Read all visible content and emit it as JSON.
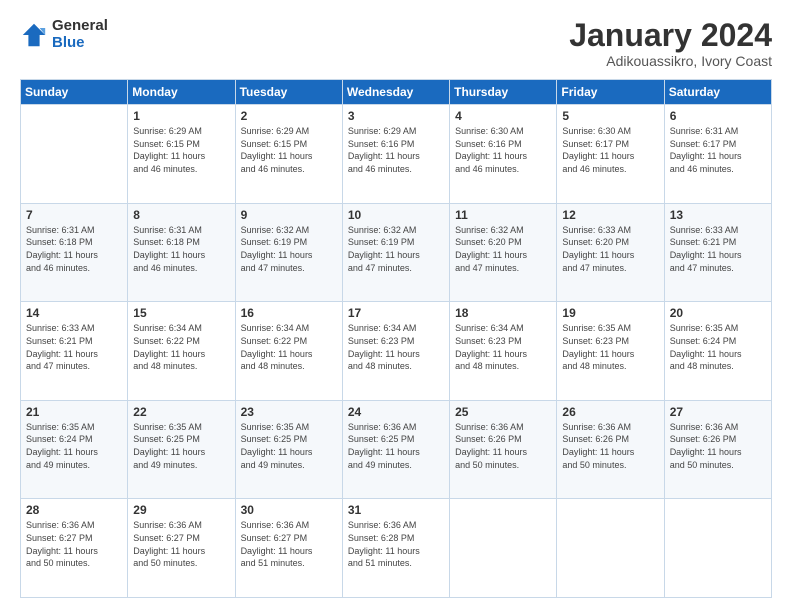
{
  "logo": {
    "general": "General",
    "blue": "Blue"
  },
  "title": "January 2024",
  "subtitle": "Adikouassikro, Ivory Coast",
  "days_header": [
    "Sunday",
    "Monday",
    "Tuesday",
    "Wednesday",
    "Thursday",
    "Friday",
    "Saturday"
  ],
  "weeks": [
    [
      {
        "day": "",
        "info": ""
      },
      {
        "day": "1",
        "info": "Sunrise: 6:29 AM\nSunset: 6:15 PM\nDaylight: 11 hours\nand 46 minutes."
      },
      {
        "day": "2",
        "info": "Sunrise: 6:29 AM\nSunset: 6:15 PM\nDaylight: 11 hours\nand 46 minutes."
      },
      {
        "day": "3",
        "info": "Sunrise: 6:29 AM\nSunset: 6:16 PM\nDaylight: 11 hours\nand 46 minutes."
      },
      {
        "day": "4",
        "info": "Sunrise: 6:30 AM\nSunset: 6:16 PM\nDaylight: 11 hours\nand 46 minutes."
      },
      {
        "day": "5",
        "info": "Sunrise: 6:30 AM\nSunset: 6:17 PM\nDaylight: 11 hours\nand 46 minutes."
      },
      {
        "day": "6",
        "info": "Sunrise: 6:31 AM\nSunset: 6:17 PM\nDaylight: 11 hours\nand 46 minutes."
      }
    ],
    [
      {
        "day": "7",
        "info": "Sunrise: 6:31 AM\nSunset: 6:18 PM\nDaylight: 11 hours\nand 46 minutes."
      },
      {
        "day": "8",
        "info": "Sunrise: 6:31 AM\nSunset: 6:18 PM\nDaylight: 11 hours\nand 46 minutes."
      },
      {
        "day": "9",
        "info": "Sunrise: 6:32 AM\nSunset: 6:19 PM\nDaylight: 11 hours\nand 47 minutes."
      },
      {
        "day": "10",
        "info": "Sunrise: 6:32 AM\nSunset: 6:19 PM\nDaylight: 11 hours\nand 47 minutes."
      },
      {
        "day": "11",
        "info": "Sunrise: 6:32 AM\nSunset: 6:20 PM\nDaylight: 11 hours\nand 47 minutes."
      },
      {
        "day": "12",
        "info": "Sunrise: 6:33 AM\nSunset: 6:20 PM\nDaylight: 11 hours\nand 47 minutes."
      },
      {
        "day": "13",
        "info": "Sunrise: 6:33 AM\nSunset: 6:21 PM\nDaylight: 11 hours\nand 47 minutes."
      }
    ],
    [
      {
        "day": "14",
        "info": "Sunrise: 6:33 AM\nSunset: 6:21 PM\nDaylight: 11 hours\nand 47 minutes."
      },
      {
        "day": "15",
        "info": "Sunrise: 6:34 AM\nSunset: 6:22 PM\nDaylight: 11 hours\nand 48 minutes."
      },
      {
        "day": "16",
        "info": "Sunrise: 6:34 AM\nSunset: 6:22 PM\nDaylight: 11 hours\nand 48 minutes."
      },
      {
        "day": "17",
        "info": "Sunrise: 6:34 AM\nSunset: 6:23 PM\nDaylight: 11 hours\nand 48 minutes."
      },
      {
        "day": "18",
        "info": "Sunrise: 6:34 AM\nSunset: 6:23 PM\nDaylight: 11 hours\nand 48 minutes."
      },
      {
        "day": "19",
        "info": "Sunrise: 6:35 AM\nSunset: 6:23 PM\nDaylight: 11 hours\nand 48 minutes."
      },
      {
        "day": "20",
        "info": "Sunrise: 6:35 AM\nSunset: 6:24 PM\nDaylight: 11 hours\nand 48 minutes."
      }
    ],
    [
      {
        "day": "21",
        "info": "Sunrise: 6:35 AM\nSunset: 6:24 PM\nDaylight: 11 hours\nand 49 minutes."
      },
      {
        "day": "22",
        "info": "Sunrise: 6:35 AM\nSunset: 6:25 PM\nDaylight: 11 hours\nand 49 minutes."
      },
      {
        "day": "23",
        "info": "Sunrise: 6:35 AM\nSunset: 6:25 PM\nDaylight: 11 hours\nand 49 minutes."
      },
      {
        "day": "24",
        "info": "Sunrise: 6:36 AM\nSunset: 6:25 PM\nDaylight: 11 hours\nand 49 minutes."
      },
      {
        "day": "25",
        "info": "Sunrise: 6:36 AM\nSunset: 6:26 PM\nDaylight: 11 hours\nand 50 minutes."
      },
      {
        "day": "26",
        "info": "Sunrise: 6:36 AM\nSunset: 6:26 PM\nDaylight: 11 hours\nand 50 minutes."
      },
      {
        "day": "27",
        "info": "Sunrise: 6:36 AM\nSunset: 6:26 PM\nDaylight: 11 hours\nand 50 minutes."
      }
    ],
    [
      {
        "day": "28",
        "info": "Sunrise: 6:36 AM\nSunset: 6:27 PM\nDaylight: 11 hours\nand 50 minutes."
      },
      {
        "day": "29",
        "info": "Sunrise: 6:36 AM\nSunset: 6:27 PM\nDaylight: 11 hours\nand 50 minutes."
      },
      {
        "day": "30",
        "info": "Sunrise: 6:36 AM\nSunset: 6:27 PM\nDaylight: 11 hours\nand 51 minutes."
      },
      {
        "day": "31",
        "info": "Sunrise: 6:36 AM\nSunset: 6:28 PM\nDaylight: 11 hours\nand 51 minutes."
      },
      {
        "day": "",
        "info": ""
      },
      {
        "day": "",
        "info": ""
      },
      {
        "day": "",
        "info": ""
      }
    ]
  ]
}
